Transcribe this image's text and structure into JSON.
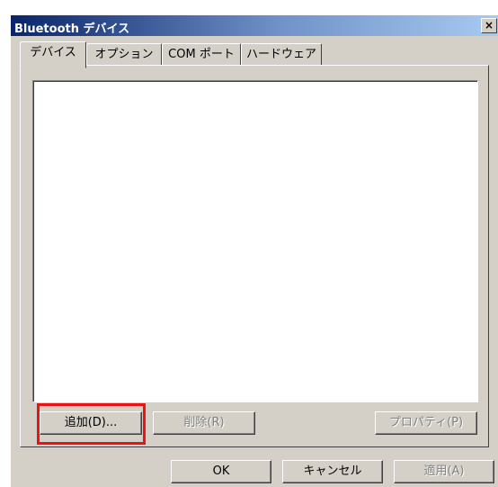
{
  "window": {
    "title": "Bluetooth デバイス",
    "close_label": "×"
  },
  "tabs": [
    {
      "label": "デバイス",
      "active": true
    },
    {
      "label": "オプション",
      "active": false
    },
    {
      "label": "COM ポート",
      "active": false
    },
    {
      "label": "ハードウェア",
      "active": false
    }
  ],
  "device_list": {
    "items": []
  },
  "panel_buttons": {
    "add": "追加(D)...",
    "remove": "削除(R)",
    "properties": "プロパティ(P)"
  },
  "dialog_buttons": {
    "ok": "OK",
    "cancel": "キャンセル",
    "apply": "適用(A)"
  },
  "colors": {
    "title_bar": "#0a246a",
    "dialog_bg": "#d4d0c8",
    "highlight": "#ee1111"
  }
}
